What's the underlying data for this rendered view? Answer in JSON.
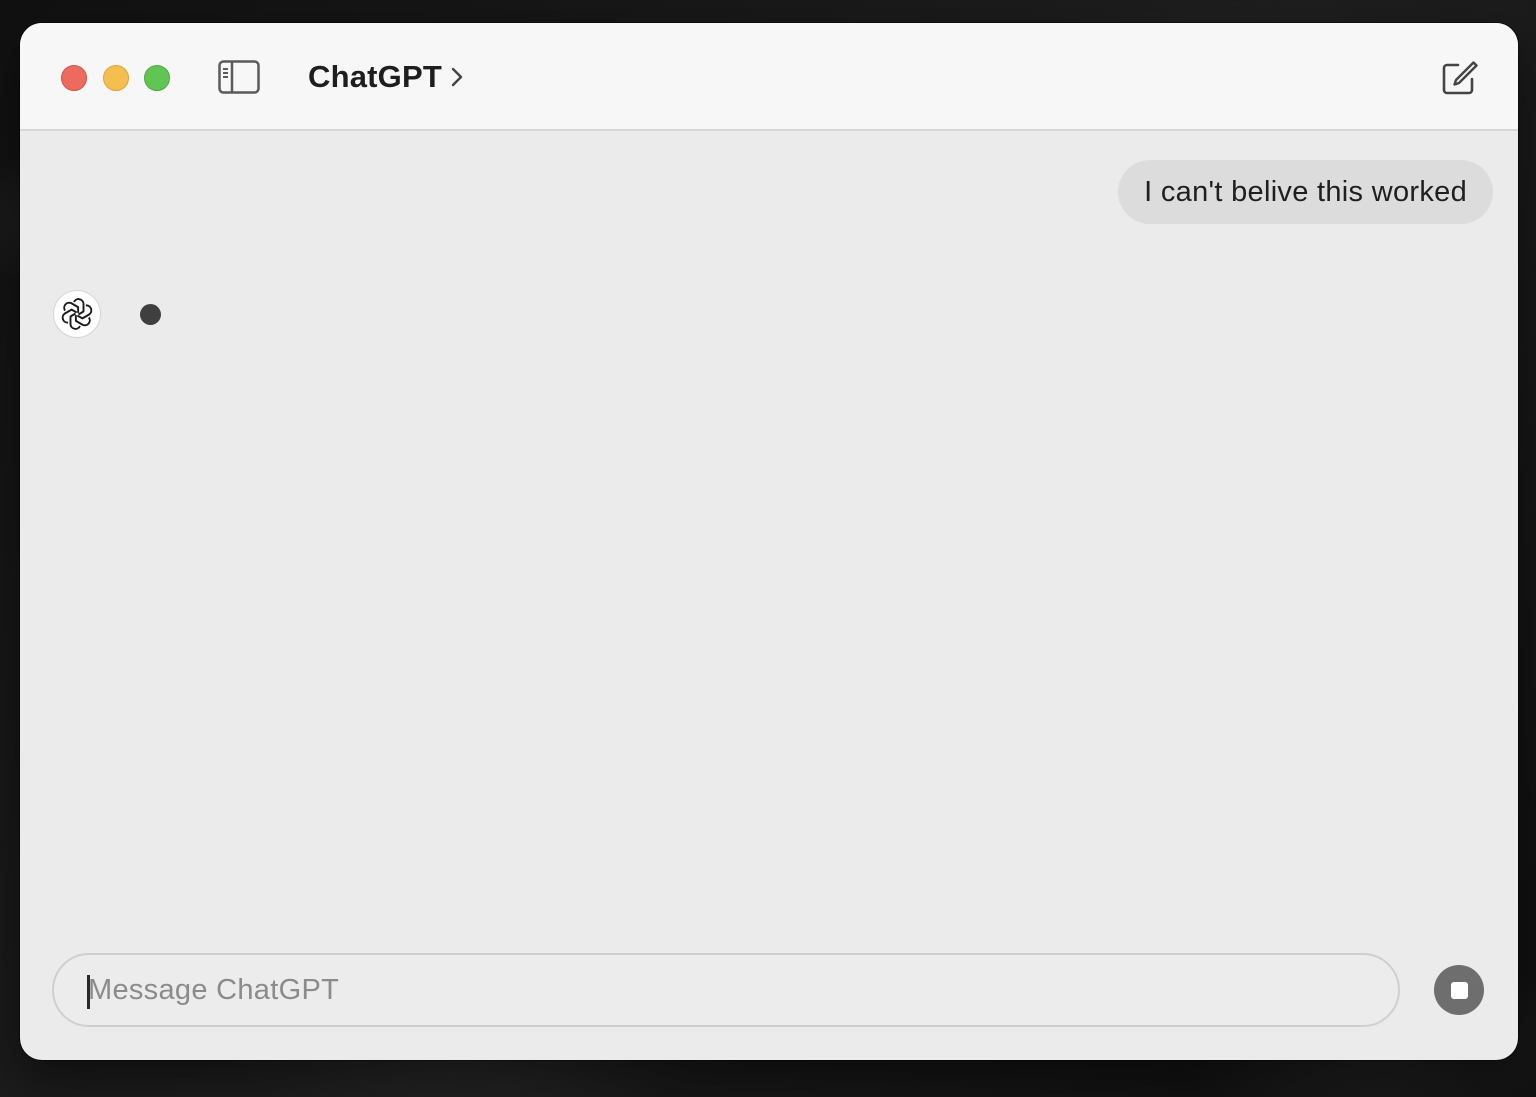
{
  "window": {
    "title": "ChatGPT",
    "traffic_lights": {
      "close_color": "#ec6a5e",
      "minimize_color": "#f4bf4f",
      "maximize_color": "#61c554"
    }
  },
  "header": {
    "title": "ChatGPT",
    "title_chevron_icon": "chevron-right-icon",
    "sidebar_toggle_icon": "sidebar-icon",
    "new_chat_icon": "compose-icon"
  },
  "conversation": {
    "messages": [
      {
        "role": "user",
        "text": "I can't belive this worked"
      },
      {
        "role": "assistant",
        "status": "typing",
        "avatar_icon": "openai-logo-icon"
      }
    ]
  },
  "composer": {
    "placeholder": "Message ChatGPT",
    "value": "",
    "action_icon": "stop-icon"
  }
}
